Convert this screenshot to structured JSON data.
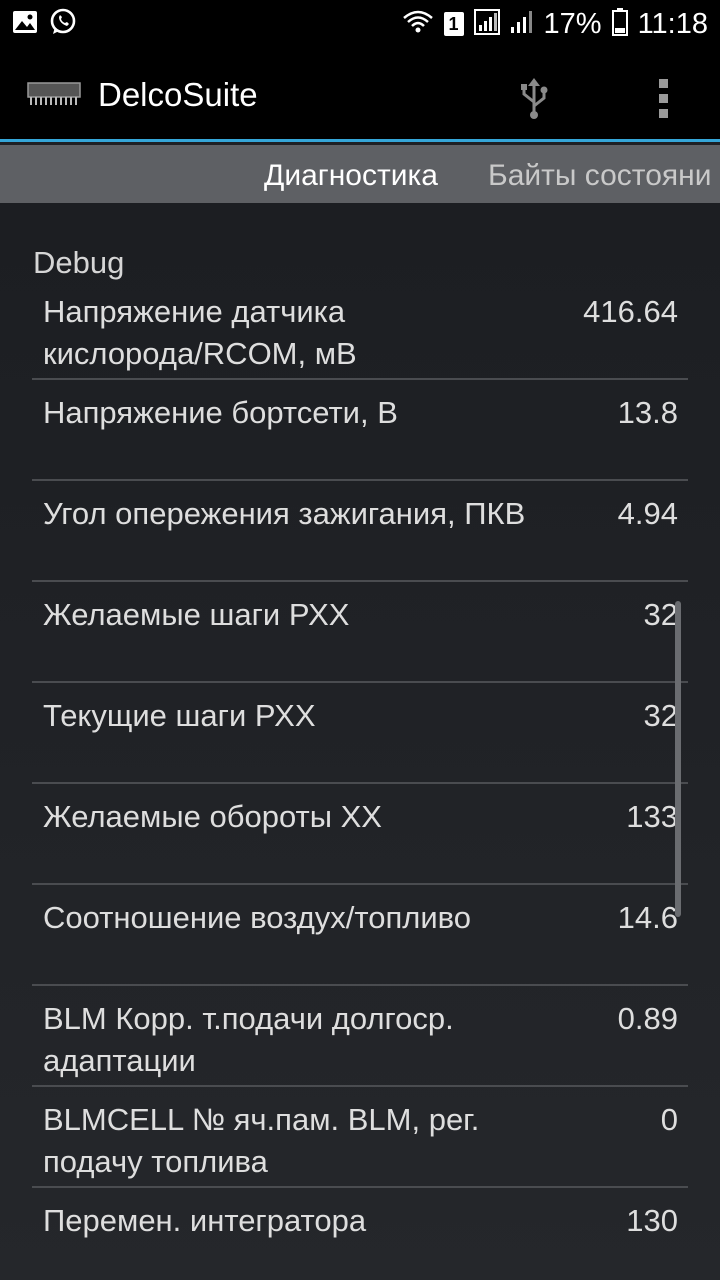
{
  "status_bar": {
    "battery_percent": "17%",
    "time": "11:18",
    "sim_number": "1",
    "icons": [
      "gallery-icon",
      "whatsapp-icon",
      "wifi-icon",
      "sim-icon",
      "signal-icon",
      "signal-icon-2",
      "battery-icon"
    ]
  },
  "action_bar": {
    "title": "DelcoSuite",
    "icons": [
      "chip-icon",
      "usb-icon",
      "overflow-menu-icon"
    ],
    "accent_color": "#35a6d8"
  },
  "tabs": [
    {
      "label": "Диагностика",
      "active": true
    },
    {
      "label": "Байты состояни",
      "active": false
    }
  ],
  "section": {
    "title": "Debug",
    "rows": [
      {
        "label": "Напряжение датчика кислорода/RCOM, мВ",
        "value": "416.64"
      },
      {
        "label": "Напряжение бортсети, В",
        "value": "13.8"
      },
      {
        "label": "Угол опережения зажигания, ПКВ",
        "value": "4.94"
      },
      {
        "label": "Желаемые шаги РХХ",
        "value": "32"
      },
      {
        "label": "Текущие шаги РХХ",
        "value": "32"
      },
      {
        "label": "Желаемые обороты ХХ",
        "value": "133"
      },
      {
        "label": "Соотношение воздух/топливо",
        "value": "14.6"
      },
      {
        "label": "BLM Корр. т.подачи долгоср. адаптации",
        "value": "0.89"
      },
      {
        "label": "BLMCELL № яч.пам. BLM, рег. подачу топлива",
        "value": "0"
      },
      {
        "label": "Перемен. интегратора",
        "value": "130"
      }
    ]
  }
}
